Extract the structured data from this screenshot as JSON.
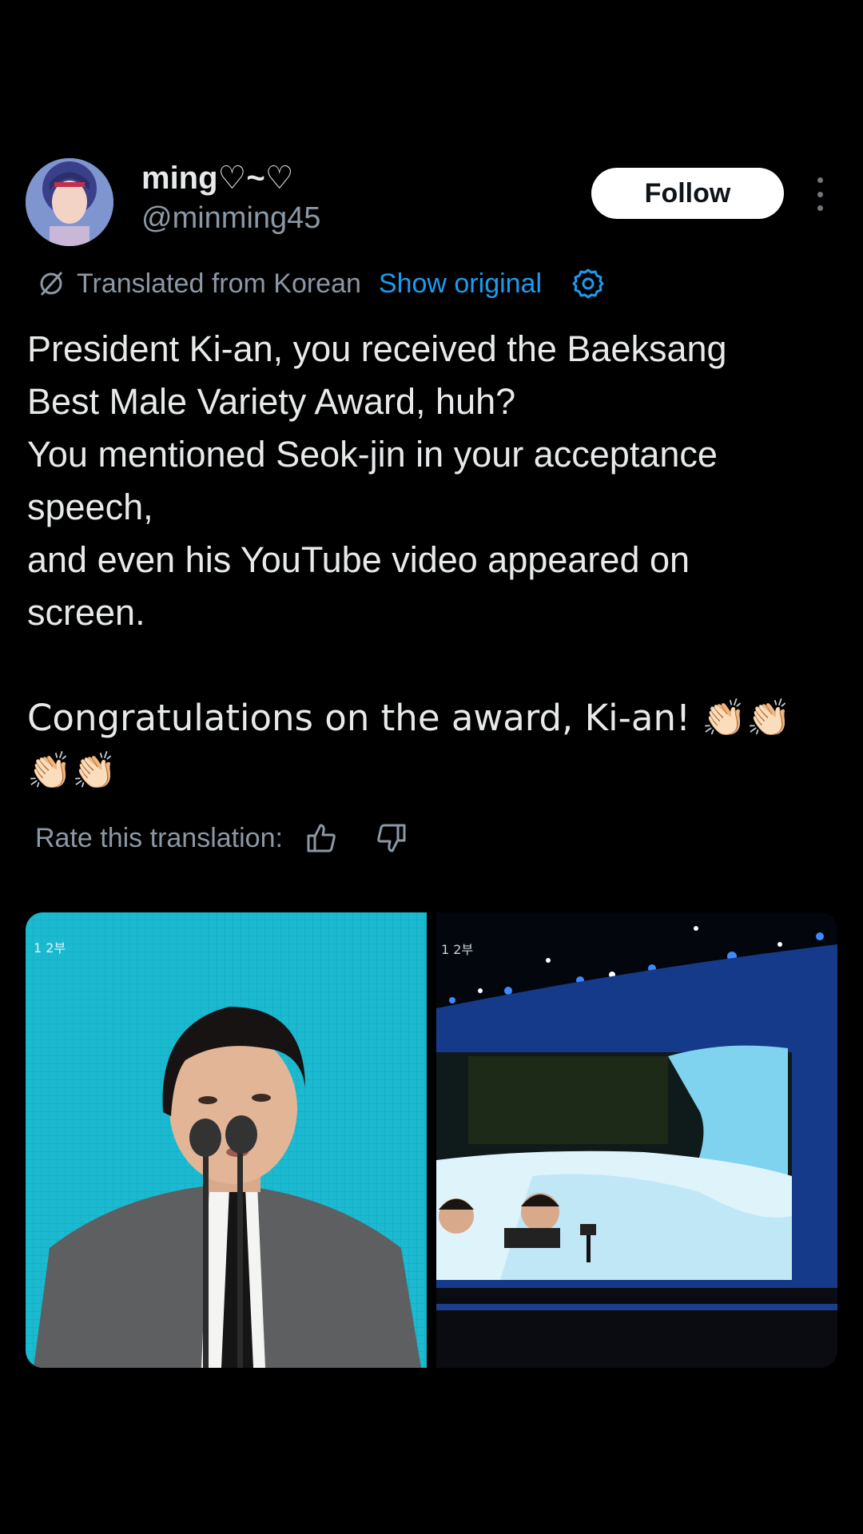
{
  "author": {
    "display_name": "ming♡~♡",
    "handle": "@minming45"
  },
  "actions": {
    "follow_label": "Follow"
  },
  "translation": {
    "translated_from": "Translated from Korean",
    "show_original": "Show original"
  },
  "tweet": {
    "lines": [
      "President Ki-an, you received the Baeksang",
      "Best Male Variety Award, huh?",
      "You mentioned Seok-jin in your acceptance",
      "speech,",
      "and even his YouTube video appeared on",
      "screen.",
      "",
      "Congratulations on the award, Ki-an! 👏🏻👏🏻",
      "👏🏻👏🏻"
    ]
  },
  "rating": {
    "label": "Rate this translation:"
  },
  "media": {
    "left_overlay": "1 2부",
    "right_overlay": "1 2부"
  },
  "colors": {
    "background": "#000000",
    "text_primary": "#e7e9ea",
    "text_secondary": "#8b98a5",
    "link": "#1d9bf0",
    "follow_bg": "#ffffff"
  },
  "icons": {
    "translate": "translate-icon",
    "settings": "gear-icon",
    "thumbs_up": "thumbs-up-icon",
    "thumbs_down": "thumbs-down-icon",
    "more": "more-dots-icon"
  }
}
